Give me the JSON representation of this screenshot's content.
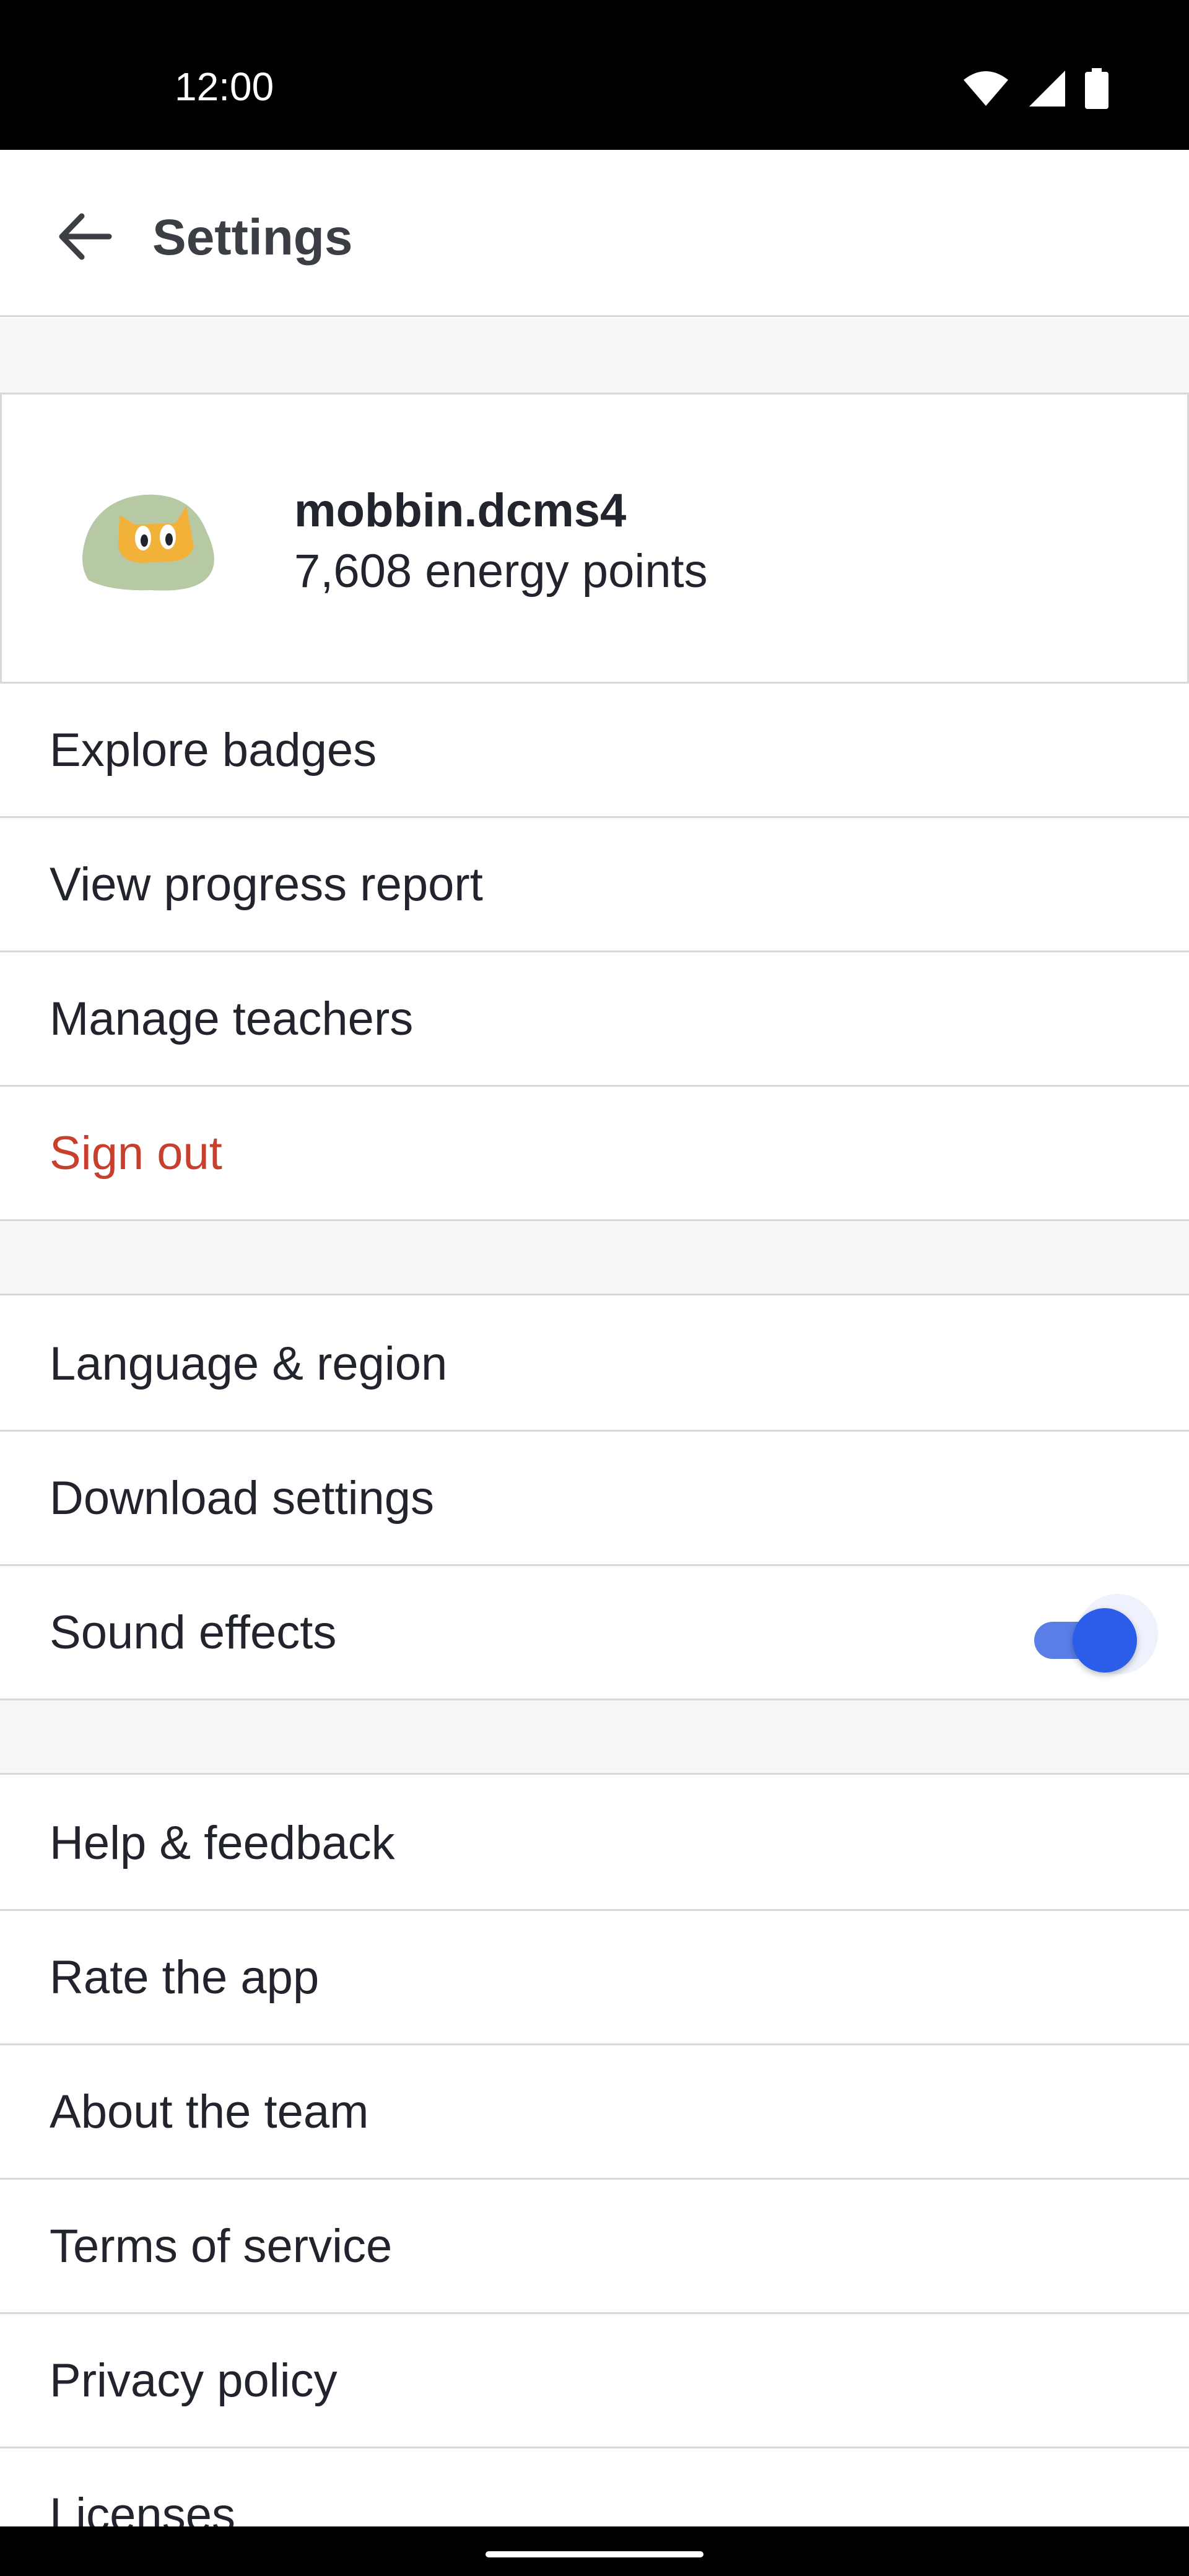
{
  "status_bar": {
    "time": "12:00",
    "icons": [
      "wifi-icon",
      "cellular-signal-icon",
      "battery-icon"
    ]
  },
  "app_bar": {
    "title": "Settings",
    "back_icon": "arrow-back-icon"
  },
  "profile": {
    "username": "mobbin.dcms4",
    "points": "7,608 energy points",
    "avatar_icon": "monster-avatar-icon"
  },
  "section_account": {
    "items": [
      {
        "label": "Explore badges"
      },
      {
        "label": "View progress report"
      },
      {
        "label": "Manage teachers"
      },
      {
        "label": "Sign out"
      }
    ]
  },
  "section_preferences": {
    "items": [
      {
        "label": "Language & region"
      },
      {
        "label": "Download settings"
      },
      {
        "label": "Sound effects",
        "toggle_on": true
      }
    ]
  },
  "section_about": {
    "items": [
      {
        "label": "Help & feedback"
      },
      {
        "label": "Rate the app"
      },
      {
        "label": "About the team"
      },
      {
        "label": "Terms of service"
      },
      {
        "label": "Privacy policy"
      },
      {
        "label": "Licenses"
      }
    ]
  },
  "colors": {
    "danger": "#c7402d",
    "toggle_accent": "#2b5de8",
    "section_background": "#f6f6f7",
    "divider": "#d6d8da"
  }
}
